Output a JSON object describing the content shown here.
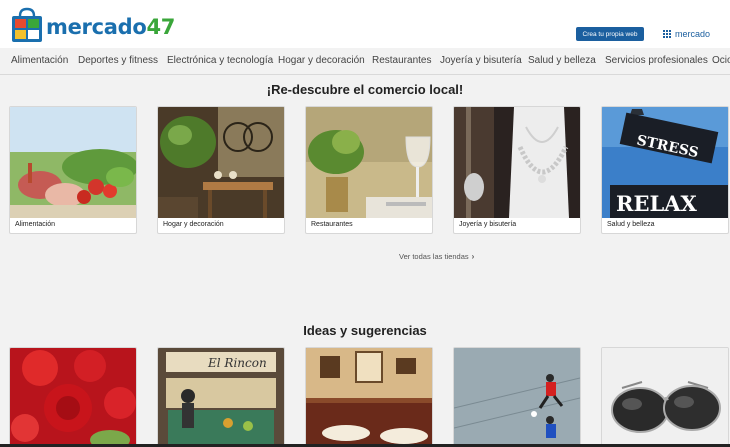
{
  "header": {
    "logo_word": "mercado",
    "logo_number": "47",
    "cta_label": "Crea tu propia web",
    "mercado_link": "mercado"
  },
  "nav": {
    "items": [
      "Alimentación",
      "Deportes y fitness",
      "Electrónica y tecnología",
      "Hogar y decoración",
      "Restaurantes",
      "Joyería y bisutería",
      "Salud y belleza",
      "Servicios profesionales",
      "Ocio"
    ]
  },
  "rediscover": {
    "title": "¡Re-descubre el comercio local!",
    "cards": [
      {
        "label": "Alimentación"
      },
      {
        "label": "Hogar y decoración"
      },
      {
        "label": "Restaurantes"
      },
      {
        "label": "Joyería y bisutería"
      },
      {
        "label": "Salud y belleza"
      }
    ],
    "see_all": "Ver todas las tiendas",
    "street_sign_top": "STRESS",
    "street_sign_bottom": "RELAX"
  },
  "ideas": {
    "title": "Ideas y sugerencias",
    "store_sign": "El Rincon"
  },
  "colors": {
    "brand_blue": "#1a6fae",
    "brand_green": "#3aa63a",
    "cta_blue": "#1b5f9f"
  },
  "icons": [
    "shopping-bag-logo-icon",
    "grid-icon",
    "chevron-right-icon"
  ]
}
